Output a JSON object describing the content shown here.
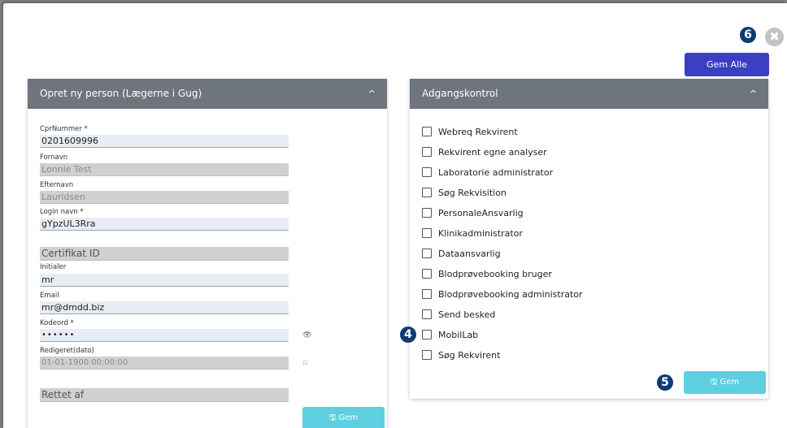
{
  "badges": {
    "b6": "6",
    "b4": "4",
    "b5": "5"
  },
  "close_icon": "✖",
  "gem_alle_label": "Gem Alle",
  "left_panel": {
    "title": "Opret ny person (Lægerne i Gug)",
    "chevron": "^",
    "fields": [
      {
        "label": "CprNummer *",
        "value": "0201609996",
        "disabled": false
      },
      {
        "label": "Fornavn",
        "value": "Lonnie Test",
        "disabled": true
      },
      {
        "label": "Efternavn",
        "value": "Lauridsen",
        "disabled": true
      },
      {
        "label": "Login navn *",
        "value": "gYpzUL3Rra",
        "disabled": false
      },
      {
        "label": "",
        "value": "Certifikat ID",
        "disabled": true
      },
      {
        "label": "Initialer",
        "value": "mr",
        "disabled": false
      },
      {
        "label": "Email",
        "value": "mr@dmdd.biz",
        "disabled": false
      },
      {
        "label": "Kodeord *",
        "value": "••••••",
        "disabled": false
      },
      {
        "label": "Redigeret(dato)",
        "value": "01-01-1900 00:00:00",
        "disabled": true
      },
      {
        "label": "",
        "value": "Rettet af",
        "disabled": true
      }
    ],
    "eye_icon": "👁",
    "calendar_icon": "▫",
    "save_label": "🖫 Gem"
  },
  "right_panel": {
    "title": "Adgangskontrol",
    "chevron": "^",
    "options": [
      "Webreq Rekvirent",
      "Rekvirent egne analyser",
      "Laboratorie administrator",
      "Søg Rekvisition",
      "PersonaleAnsvarlig",
      "Klinikadministrator",
      "Dataansvarlig",
      "Blodprøvebooking bruger",
      "Blodprøvebooking administrator",
      "Send besked",
      "MobilLab",
      "Søg Rekvirent"
    ],
    "save_label": "🖫 Gem"
  }
}
